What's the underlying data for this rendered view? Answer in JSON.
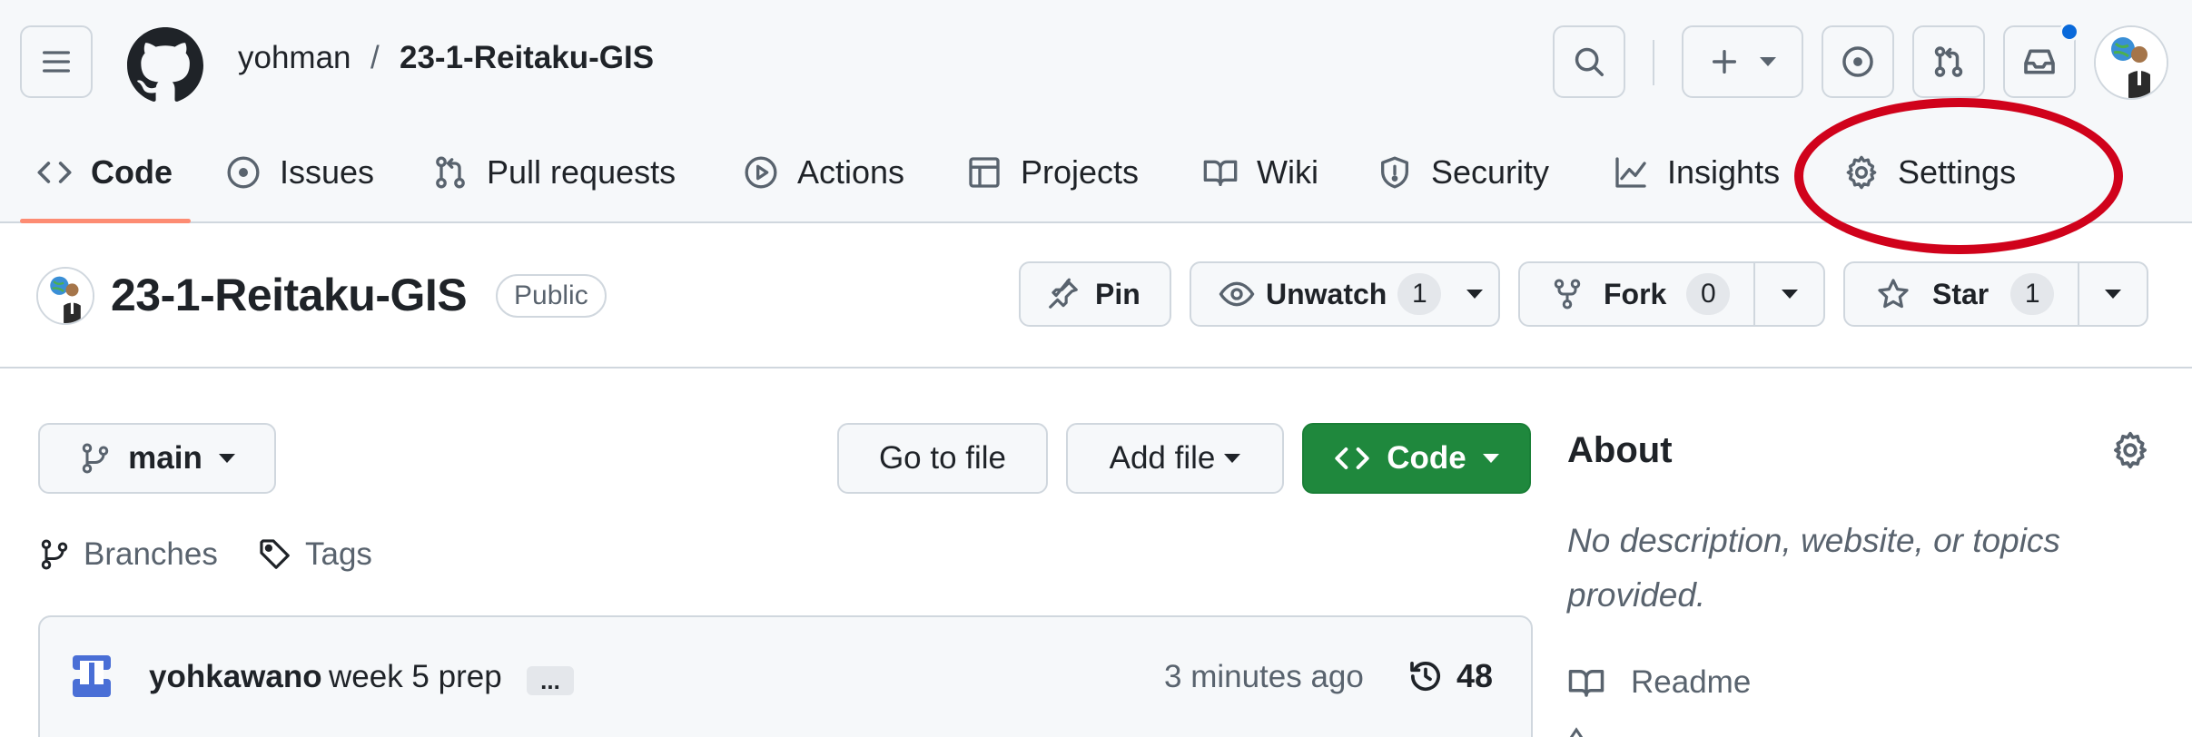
{
  "header": {
    "owner": "yohman",
    "separator": "/",
    "repo": "23-1-Reitaku-GIS"
  },
  "nav": {
    "tabs": [
      {
        "label": "Code",
        "icon": "code-icon",
        "active": true
      },
      {
        "label": "Issues",
        "icon": "issue-opened-icon"
      },
      {
        "label": "Pull requests",
        "icon": "git-pull-request-icon"
      },
      {
        "label": "Actions",
        "icon": "play-icon"
      },
      {
        "label": "Projects",
        "icon": "table-icon"
      },
      {
        "label": "Wiki",
        "icon": "book-icon"
      },
      {
        "label": "Security",
        "icon": "shield-icon"
      },
      {
        "label": "Insights",
        "icon": "graph-icon"
      },
      {
        "label": "Settings",
        "icon": "gear-icon"
      }
    ],
    "highlight_color": "#d0021b",
    "active_underline_color": "#fd8c73"
  },
  "repo": {
    "title": "23-1-Reitaku-GIS",
    "visibility": "Public",
    "pin_label": "Pin",
    "watch_label": "Unwatch",
    "watch_count": "1",
    "fork_label": "Fork",
    "fork_count": "0",
    "star_label": "Star",
    "star_count": "1"
  },
  "files": {
    "branch": "main",
    "go_to_file": "Go to file",
    "add_file": "Add file",
    "code_button": "Code",
    "code_button_color": "#1f883d",
    "branches_label": "Branches",
    "tags_label": "Tags"
  },
  "commit": {
    "author": "yohkawano",
    "message": "week 5 prep",
    "ellipsis": "...",
    "time": "3 minutes ago",
    "count": "48"
  },
  "about": {
    "title": "About",
    "description": "No description, website, or topics provided.",
    "readme_label": "Readme"
  }
}
